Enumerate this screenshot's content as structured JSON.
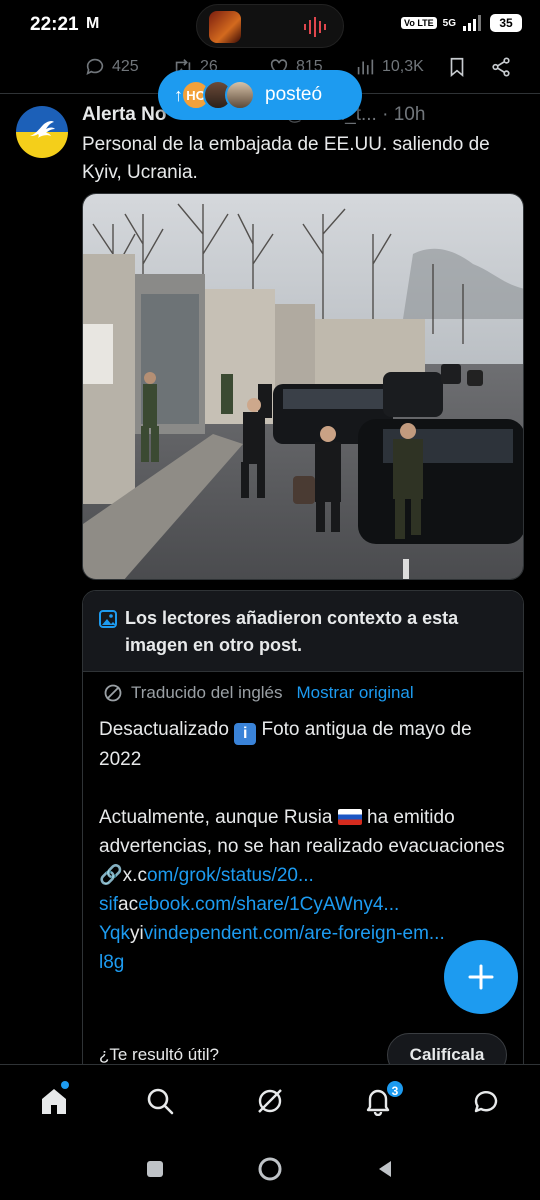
{
  "status": {
    "time": "22:21",
    "carrier_icon": "M",
    "volte": "Vo LTE",
    "network": "5G",
    "battery": "35"
  },
  "prev_post": {
    "replies": "425",
    "reposts": "26",
    "likes": "815",
    "views": "10,3K"
  },
  "posted_pill": {
    "arrow": "↑",
    "text": "posteó"
  },
  "post": {
    "name": "Alerta No",
    "handle": "@UKR_t...",
    "time": "· 10h",
    "text": "Personal de la embajada de EE.UU. saliendo de Kyiv, Ucrania."
  },
  "note": {
    "title": "Los lectores añadieron contexto a esta imagen en otro post.",
    "translated": "Traducido del inglés",
    "show_original": "Mostrar original",
    "line1_a": "Desactualizado",
    "line1_b": "Foto antigua de mayo de 2022",
    "para2": "Actualmente, aunque Rusia",
    "para2_b": "ha emitido advertencias, no se han realizado evacuaciones",
    "link1_prefix": "x.c",
    "link1": "om/grok/status/20...",
    "link2_prefix": "sif",
    "link2_mid": "ac",
    "link2": "ebook.com/share/1CyAWny4...",
    "link3_prefix": "Yqk",
    "link3_mid": "yi",
    "link3": "vindependent.com/are-foreign-em...",
    "link3_tail": "l8g",
    "question": "¿Te resultó útil?",
    "rate": "Califícala"
  },
  "nav": {
    "notif_count": "3"
  },
  "colors": {
    "accent": "#1d9bf0",
    "bg": "#000000",
    "muted": "#71767b"
  }
}
